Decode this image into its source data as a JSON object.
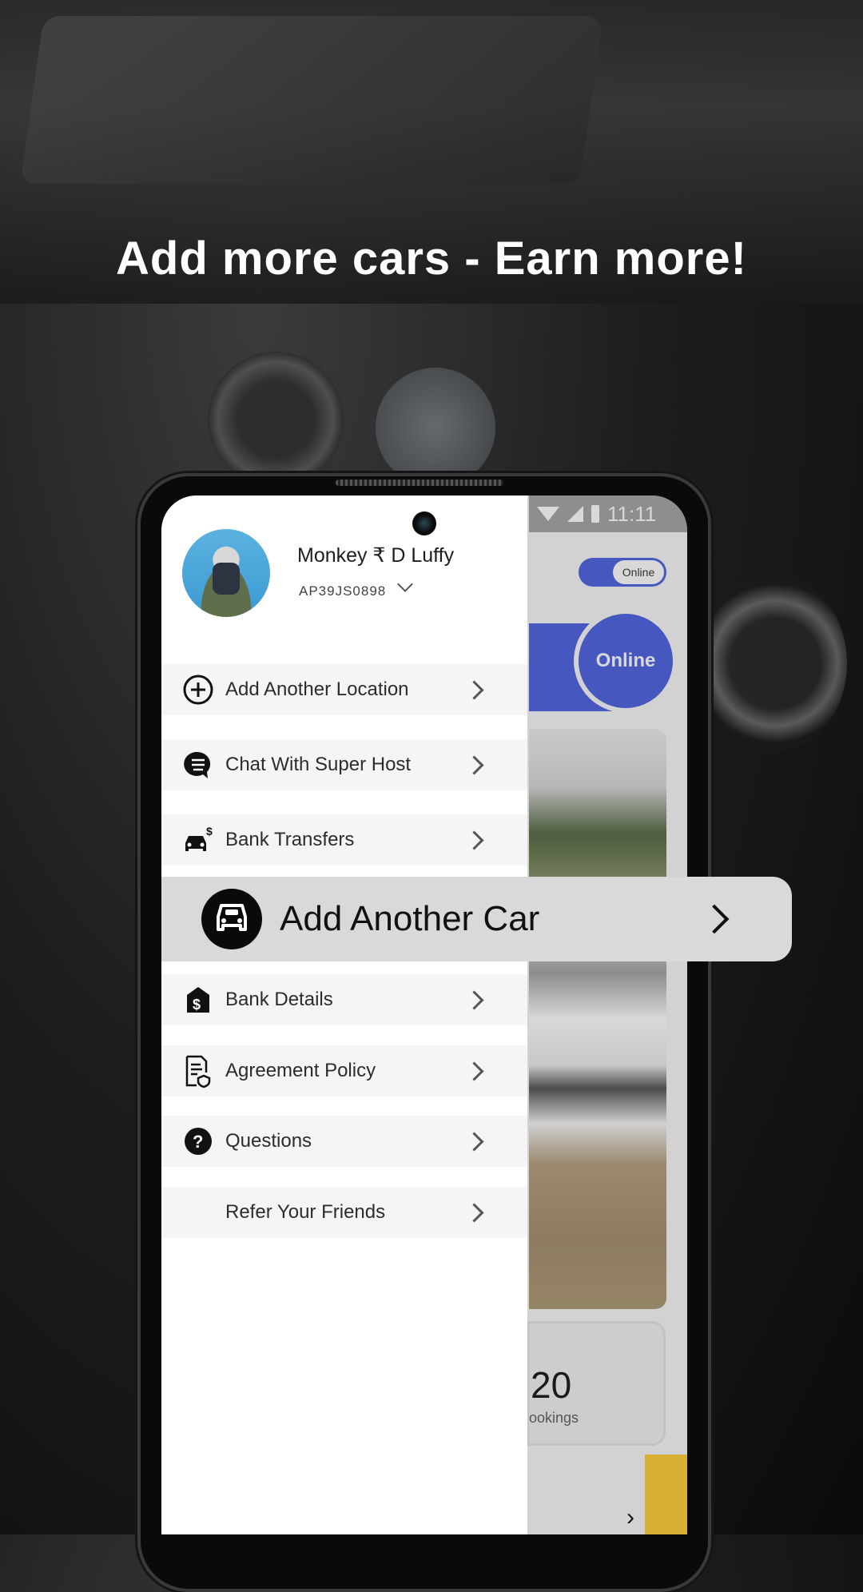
{
  "headline": "Add more cars - Earn more!",
  "status_bar": {
    "time": "11:11"
  },
  "app_behind": {
    "toggle_label": "Online",
    "status_label": "Online",
    "stats_value": "20",
    "stats_label": "ookings"
  },
  "drawer": {
    "user_name": "Monkey ₹ D Luffy",
    "user_id": "AP39JS0898",
    "items": [
      {
        "label": "Add Another Location",
        "icon": "plus-circle-icon"
      },
      {
        "label": "Chat With Super Host",
        "icon": "chat-icon"
      },
      {
        "label": "Bank Transfers",
        "icon": "car-dollar-icon"
      },
      {
        "label": "Add Another Car",
        "icon": "car-icon"
      },
      {
        "label": "Bank Details",
        "icon": "bank-dollar-icon"
      },
      {
        "label": "Agreement Policy",
        "icon": "document-shield-icon"
      },
      {
        "label": "Questions",
        "icon": "question-circle-icon"
      },
      {
        "label": "Refer Your Friends",
        "icon": ""
      }
    ]
  }
}
